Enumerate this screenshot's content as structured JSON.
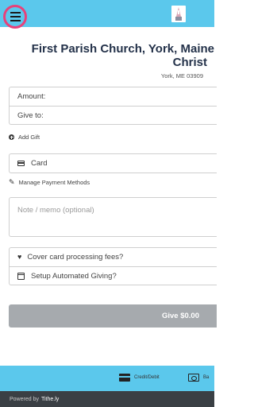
{
  "header": {
    "menu_icon": "hamburger-menu-icon",
    "logo_icon": "church-logo"
  },
  "church": {
    "name": "First Parish Church, York, Maine",
    "subtitle": "Christ",
    "address": "York, ME 03909"
  },
  "form": {
    "amount_label": "Amount:",
    "give_to_label": "Give to:",
    "add_gift_label": "Add Gift",
    "payment_method_label": "Card",
    "manage_payment_label": "Manage Payment Methods",
    "memo_placeholder": "Note / memo (optional)",
    "cover_fees_label": "Cover card processing fees?",
    "automated_giving_label": "Setup Automated Giving?",
    "give_button_label": "Give $0.00"
  },
  "payment_options": {
    "credit_debit_label": "Credit/Debit",
    "bank_label": "Ba"
  },
  "footer": {
    "powered_by": "Powered by",
    "brand": "Tithe.ly"
  },
  "colors": {
    "accent": "#5bc8ec",
    "menu_highlight": "#e8417a",
    "button_disabled": "#a6aaae",
    "footer": "#3a3f44"
  }
}
